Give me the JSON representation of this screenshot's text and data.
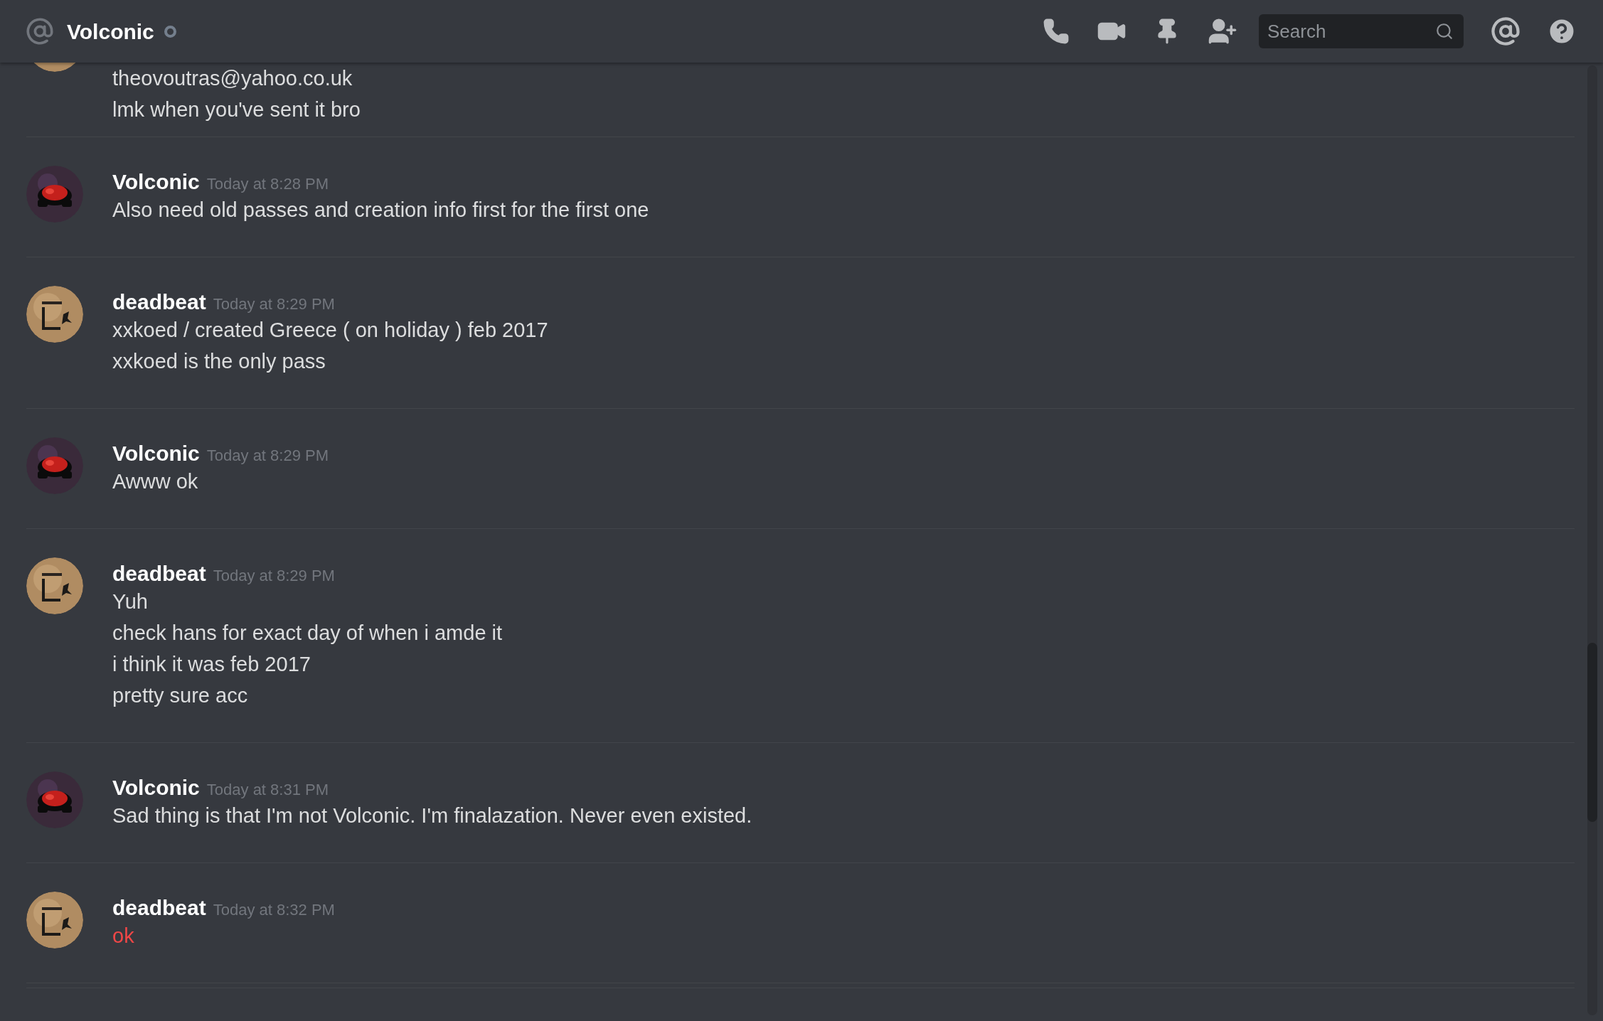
{
  "header": {
    "title": "Volconic",
    "search": {
      "placeholder": "Search"
    }
  },
  "messages": [
    {
      "kind": "poster",
      "failed": false,
      "lines": [
        "theovoutras@yahoo.co.uk",
        "lmk when you've sent it bro"
      ]
    },
    {
      "author": "Volconic",
      "time": "Today at 8:28 PM",
      "kind": "mask",
      "failed": false,
      "lines": [
        "Also need old passes and creation info first for the first one"
      ]
    },
    {
      "author": "deadbeat",
      "time": "Today at 8:29 PM",
      "kind": "poster",
      "failed": false,
      "lines": [
        "xxkoed / created Greece ( on holiday ) feb 2017",
        "xxkoed is the only pass"
      ]
    },
    {
      "author": "Volconic",
      "time": "Today at 8:29 PM",
      "kind": "mask",
      "failed": false,
      "lines": [
        "Awww ok"
      ]
    },
    {
      "author": "deadbeat",
      "time": "Today at 8:29 PM",
      "kind": "poster",
      "failed": false,
      "lines": [
        "Yuh",
        "check hans for exact day of when i amde it",
        "i think it was feb 2017",
        "pretty sure acc"
      ]
    },
    {
      "author": "Volconic",
      "time": "Today at 8:31 PM",
      "kind": "mask",
      "failed": false,
      "lines": [
        "Sad thing is that I'm not Volconic. I'm finalazation. Never even existed."
      ]
    },
    {
      "author": "deadbeat",
      "time": "Today at 8:32 PM",
      "kind": "poster",
      "failed": true,
      "lines": [
        "ok"
      ]
    }
  ]
}
